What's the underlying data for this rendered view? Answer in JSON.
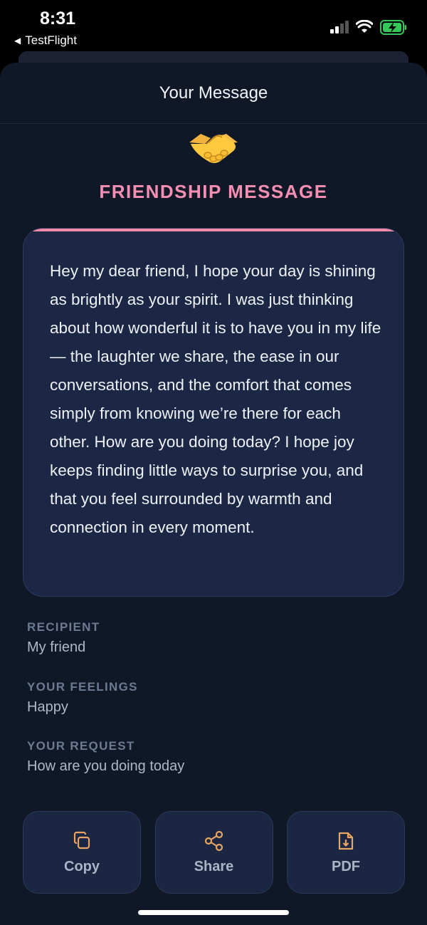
{
  "status_bar": {
    "time": "8:31",
    "back_app": "TestFlight"
  },
  "header": {
    "title": "Your Message"
  },
  "message": {
    "category": "FRIENDSHIP MESSAGE",
    "emoji": "handshake",
    "body": "Hey my dear friend, I hope your day is shining as brightly as your spirit. I was just thinking about how wonderful it is to have you in my life — the laughter we share, the ease in our conversations, and the comfort that comes simply from knowing we’re there for each other. How are you doing today? I hope joy keeps finding little ways to surprise you, and that you feel surrounded by warmth and connection in every moment."
  },
  "details": [
    {
      "label": "RECIPIENT",
      "value": "My friend"
    },
    {
      "label": "YOUR FEELINGS",
      "value": "Happy"
    },
    {
      "label": "YOUR REQUEST",
      "value": "How are you doing today"
    }
  ],
  "actions": [
    {
      "label": "Copy",
      "icon": "copy-icon"
    },
    {
      "label": "Share",
      "icon": "share-icon"
    },
    {
      "label": "PDF",
      "icon": "file-download-icon"
    }
  ],
  "colors": {
    "accent_pink": "#f58fb1",
    "icon_orange": "#e8a463",
    "background": "#101828",
    "card": "#1b2745"
  }
}
